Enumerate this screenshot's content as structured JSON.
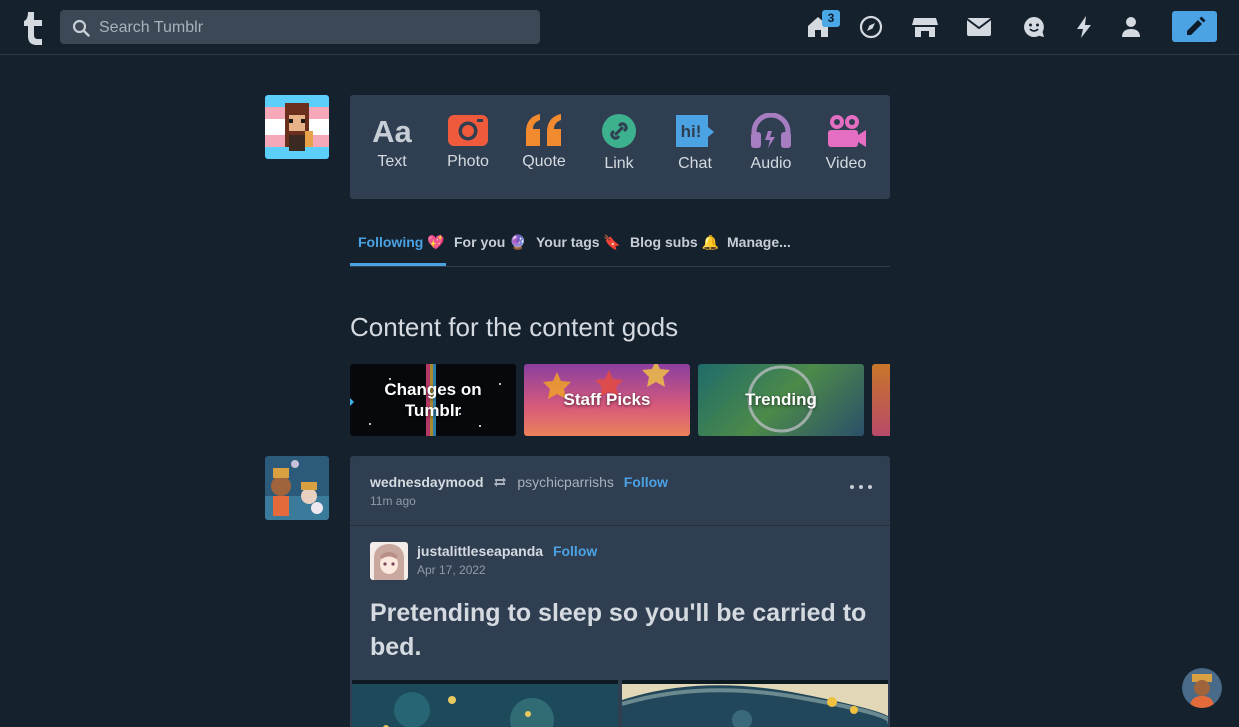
{
  "search": {
    "placeholder": "Search Tumblr"
  },
  "nav": {
    "home_badge": "3"
  },
  "post_types": [
    {
      "label": "Text",
      "icon": "text-icon",
      "color": "#c7ced6"
    },
    {
      "label": "Photo",
      "icon": "camera-icon",
      "color": "#ef5a3c"
    },
    {
      "label": "Quote",
      "icon": "quote-icon",
      "color": "#f28a30"
    },
    {
      "label": "Link",
      "icon": "link-icon",
      "color": "#3db08d"
    },
    {
      "label": "Chat",
      "icon": "chat-icon",
      "color": "#4ba3e3"
    },
    {
      "label": "Audio",
      "icon": "headphones-icon",
      "color": "#a77dc2"
    },
    {
      "label": "Video",
      "icon": "video-icon",
      "color": "#e36ec2"
    }
  ],
  "tabs": [
    {
      "label": "Following 💖"
    },
    {
      "label": "For you 🔮"
    },
    {
      "label": "Your tags 🔖"
    },
    {
      "label": "Blog subs 🔔"
    },
    {
      "label": "Manage..."
    }
  ],
  "section": {
    "title": "Content for the content gods"
  },
  "cards": [
    {
      "label": "Changes on Tumblr"
    },
    {
      "label": "Staff Picks"
    },
    {
      "label": "Trending"
    }
  ],
  "post": {
    "reblogger": "wednesdaymood",
    "reblogged_from": "psychicparrishs",
    "follow_label": "Follow",
    "time": "11m ago",
    "source_user": "justalittleseapanda",
    "source_follow_label": "Follow",
    "source_date": "Apr 17, 2022",
    "text": "Pretending to sleep so you'll be carried to bed."
  },
  "colors": {
    "accent": "#4ba3e3",
    "background": "#16212e",
    "panel": "#2f3e51"
  }
}
